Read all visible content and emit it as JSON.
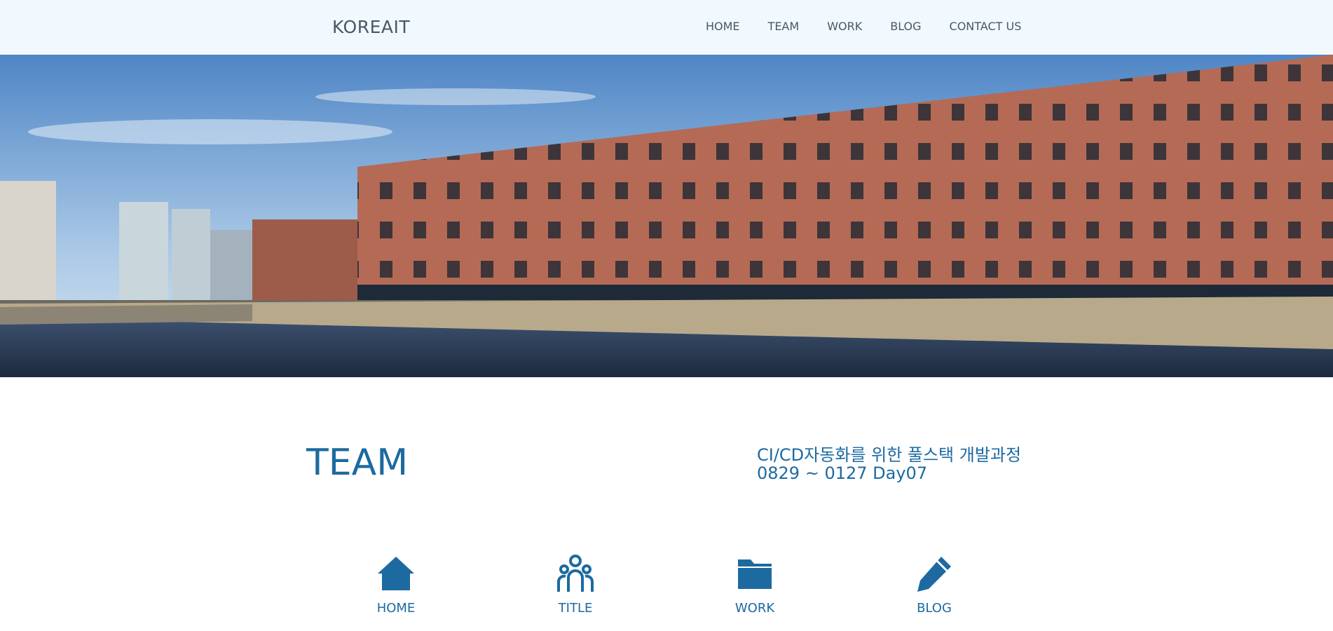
{
  "header": {
    "logo": "KOREAIT",
    "nav": [
      "HOME",
      "TEAM",
      "WORK",
      "BLOG",
      "CONTACT US"
    ]
  },
  "hero": {
    "image": "brick-warehouse-dock-photo"
  },
  "section": {
    "title": "TEAM",
    "course_line1": "CI/CD자동화를 위한 풀스택 개발과정",
    "course_line2": "0829 ~ 0127 Day07"
  },
  "features": [
    {
      "icon": "home-icon",
      "label": "HOME",
      "desc": ""
    },
    {
      "icon": "people-icon",
      "label": "TITLE",
      "desc": ""
    },
    {
      "icon": "folder-icon",
      "label": "WORK",
      "desc": ""
    },
    {
      "icon": "pencil-icon",
      "label": "BLOG",
      "desc": ""
    }
  ],
  "colors": {
    "accent": "#1c6aa0",
    "header_bg": "#f1f8fe",
    "nav_text": "#4a5766"
  }
}
